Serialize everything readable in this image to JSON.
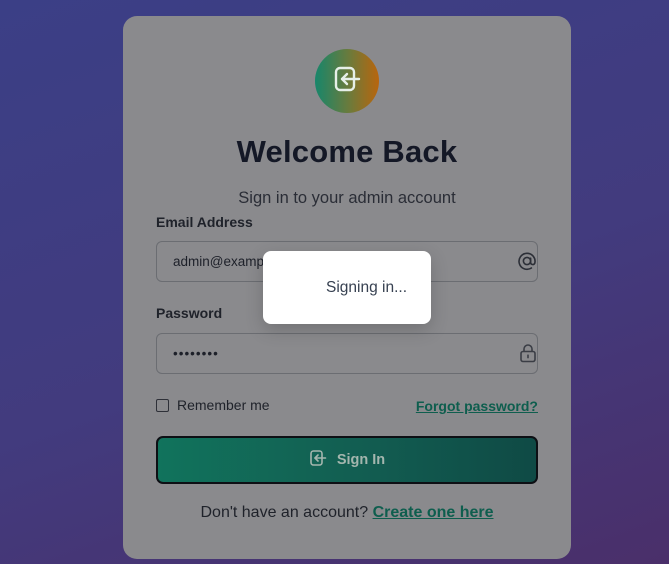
{
  "card": {
    "title": "Welcome Back",
    "subtitle": "Sign in to your admin account"
  },
  "email": {
    "label": "Email Address",
    "value": "admin@example.com",
    "icon": "at-icon"
  },
  "password": {
    "label": "Password",
    "value": "••••••••",
    "icon": "lock-icon"
  },
  "remember": {
    "label": "Remember me",
    "checked": false
  },
  "forgot": {
    "label": "Forgot password?"
  },
  "submit": {
    "label": "Sign In",
    "icon": "sign-in-icon"
  },
  "signup": {
    "prompt": "Don't have an account?",
    "link": "Create one here"
  },
  "toast": {
    "text": "Signing in..."
  },
  "colors": {
    "accent": "#0e5e4e",
    "button": "#11735c",
    "logo_start": "#17866b",
    "logo_end": "#b9650d"
  }
}
